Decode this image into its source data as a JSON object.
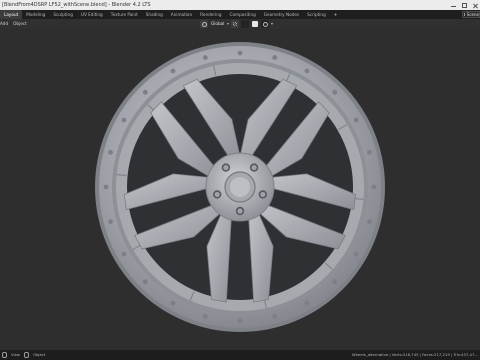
{
  "window": {
    "title": "[BlendFrom4DSRP LF52_withScene.blend] - Blender 4.2 LTS"
  },
  "workspace": {
    "tabs": [
      "Layout",
      "Modeling",
      "Sculpting",
      "UV Editing",
      "Texture Paint",
      "Shading",
      "Animation",
      "Rendering",
      "Compositing",
      "Geometry Nodes",
      "Scripting"
    ],
    "active_tab": "Layout",
    "add_tab": "+",
    "scene": "Scene"
  },
  "header": {
    "menu": [
      "Add",
      "Object"
    ],
    "transform_orientation": "Global"
  },
  "statusbar": {
    "left": [
      "View",
      "Object"
    ],
    "stats": "Wheels_alternative | Verts:218,745 | Faces:217,219 | Tris:437,47..."
  },
  "colors": {
    "viewport_bg": "#2e2e2e",
    "wheel_metal": "#9a9ea4",
    "accent_active_tab": "#3d3d3d"
  },
  "icons": {
    "mouse": "mouse-icon",
    "snap": "snap-magnet-icon",
    "proportional": "proportional-edit-icon"
  }
}
